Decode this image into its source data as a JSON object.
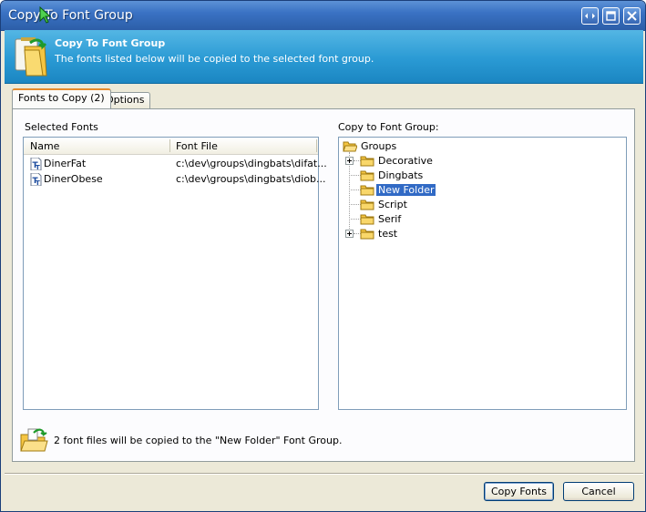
{
  "window": {
    "title": "Copy To Font Group"
  },
  "header": {
    "title": "Copy To Font Group",
    "subtitle": "The fonts listed below will be copied to the selected font group."
  },
  "tabs": [
    {
      "label": "Fonts to Copy (2)",
      "active": true
    },
    {
      "label": "Options",
      "active": false
    }
  ],
  "selected_fonts": {
    "label": "Selected Fonts",
    "columns": [
      "Name",
      "Font File"
    ],
    "rows": [
      {
        "name": "DinerFat",
        "file": "c:\\dev\\groups\\dingbats\\difat..."
      },
      {
        "name": "DinerObese",
        "file": "c:\\dev\\groups\\dingbats\\diob..."
      }
    ]
  },
  "font_group": {
    "label": "Copy to Font Group:",
    "root": "Groups",
    "items": [
      {
        "label": "Decorative",
        "expandable": true,
        "selected": false
      },
      {
        "label": "Dingbats",
        "expandable": false,
        "selected": false
      },
      {
        "label": "New Folder",
        "expandable": false,
        "selected": true
      },
      {
        "label": "Script",
        "expandable": false,
        "selected": false
      },
      {
        "label": "Serif",
        "expandable": false,
        "selected": false
      },
      {
        "label": "test",
        "expandable": true,
        "selected": false
      }
    ]
  },
  "status": {
    "message": "2 font files will be copied to the \"New Folder\" Font Group."
  },
  "buttons": {
    "copy_label": "Copy Fonts",
    "cancel_label": "Cancel"
  },
  "colors": {
    "titlebar": "#3a72c4",
    "header_band": "#2a9ad4",
    "selection": "#316ac5",
    "tab_accent": "#e68b2c"
  }
}
